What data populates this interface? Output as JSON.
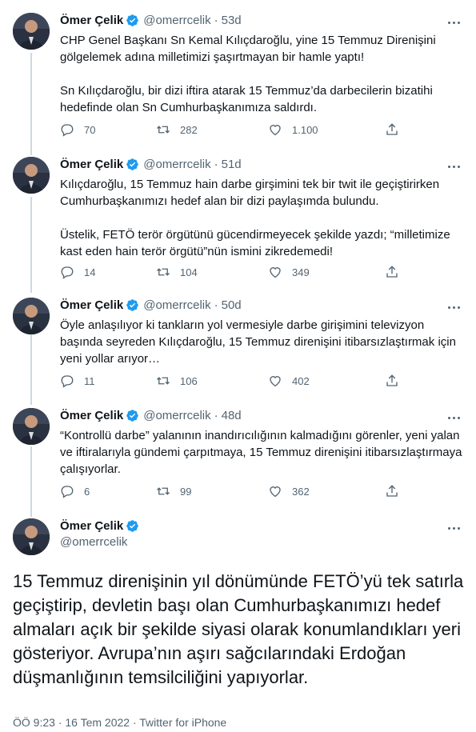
{
  "author": {
    "name": "Ömer Çelik",
    "handle": "@omerrcelik"
  },
  "colors": {
    "verified": "#1d9bf0",
    "text": "#0f1419",
    "muted": "#536471",
    "thread_line": "#cfd9de"
  },
  "tweets": [
    {
      "time": "53d",
      "paragraphs": [
        "CHP Genel Başkanı Sn Kemal Kılıçdaroğlu, yine 15 Temmuz Direnişini gölgelemek adına milletimizi şaşırtmayan bir hamle yaptı!",
        "Sn Kılıçdaroğlu, bir dizi iftira atarak 15 Temmuz’da darbecilerin bizatihi hedefinde olan Sn Cumhurbaşkanımıza saldırdı."
      ],
      "replies": "70",
      "retweets": "282",
      "likes": "1.100"
    },
    {
      "time": "51d",
      "paragraphs": [
        "Kılıçdaroğlu, 15 Temmuz hain darbe girşimini tek bir twit ile geçiştirirken Cumhurbaşkanımızı hedef alan bir dizi paylaşımda bulundu.",
        "Üstelik, FETÖ terör örgütünü gücendirmeyecek şekilde yazdı; “milletimize kast eden hain terör örgütü”nün ismini zikredemedi!"
      ],
      "replies": "14",
      "retweets": "104",
      "likes": "349"
    },
    {
      "time": "50d",
      "paragraphs": [
        "Öyle anlaşılıyor ki tankların yol vermesiyle darbe girişimini televizyon başında seyreden Kılıçdaroğlu, 15 Temmuz direnişini itibarsızlaştırmak için yeni yollar arıyor…"
      ],
      "replies": "11",
      "retweets": "106",
      "likes": "402"
    },
    {
      "time": "48d",
      "paragraphs": [
        "“Kontrollü darbe” yalanının inandırıcılığının kalmadığını görenler, yeni yalan ve iftiralarıyla gündemi çarpıtmaya, 15 Temmuz direnişini itibarsızlaştırmaya çalışıyorlar."
      ],
      "replies": "6",
      "retweets": "99",
      "likes": "362"
    }
  ],
  "main_tweet": {
    "text": "15 Temmuz direnişinin yıl dönümünde FETÖ’yü tek satırla geçiştirip, devletin başı olan Cumhurbaşkanımızı hedef almaları açık bir şekilde siyasi olarak konumlandıkları yeri gösteriyor. Avrupa’nın aşırı sağcılarındaki Erdoğan düşmanlığının temsilciliğini yapıyorlar.",
    "time": "ÖÖ 9:23",
    "separator": "·",
    "date": "16 Tem 2022",
    "source": "Twitter for iPhone"
  },
  "icons": {
    "reply": "reply-icon",
    "retweet": "retweet-icon",
    "like": "heart-icon",
    "share": "share-icon",
    "verified": "verified-badge-icon",
    "more": "more-icon"
  }
}
